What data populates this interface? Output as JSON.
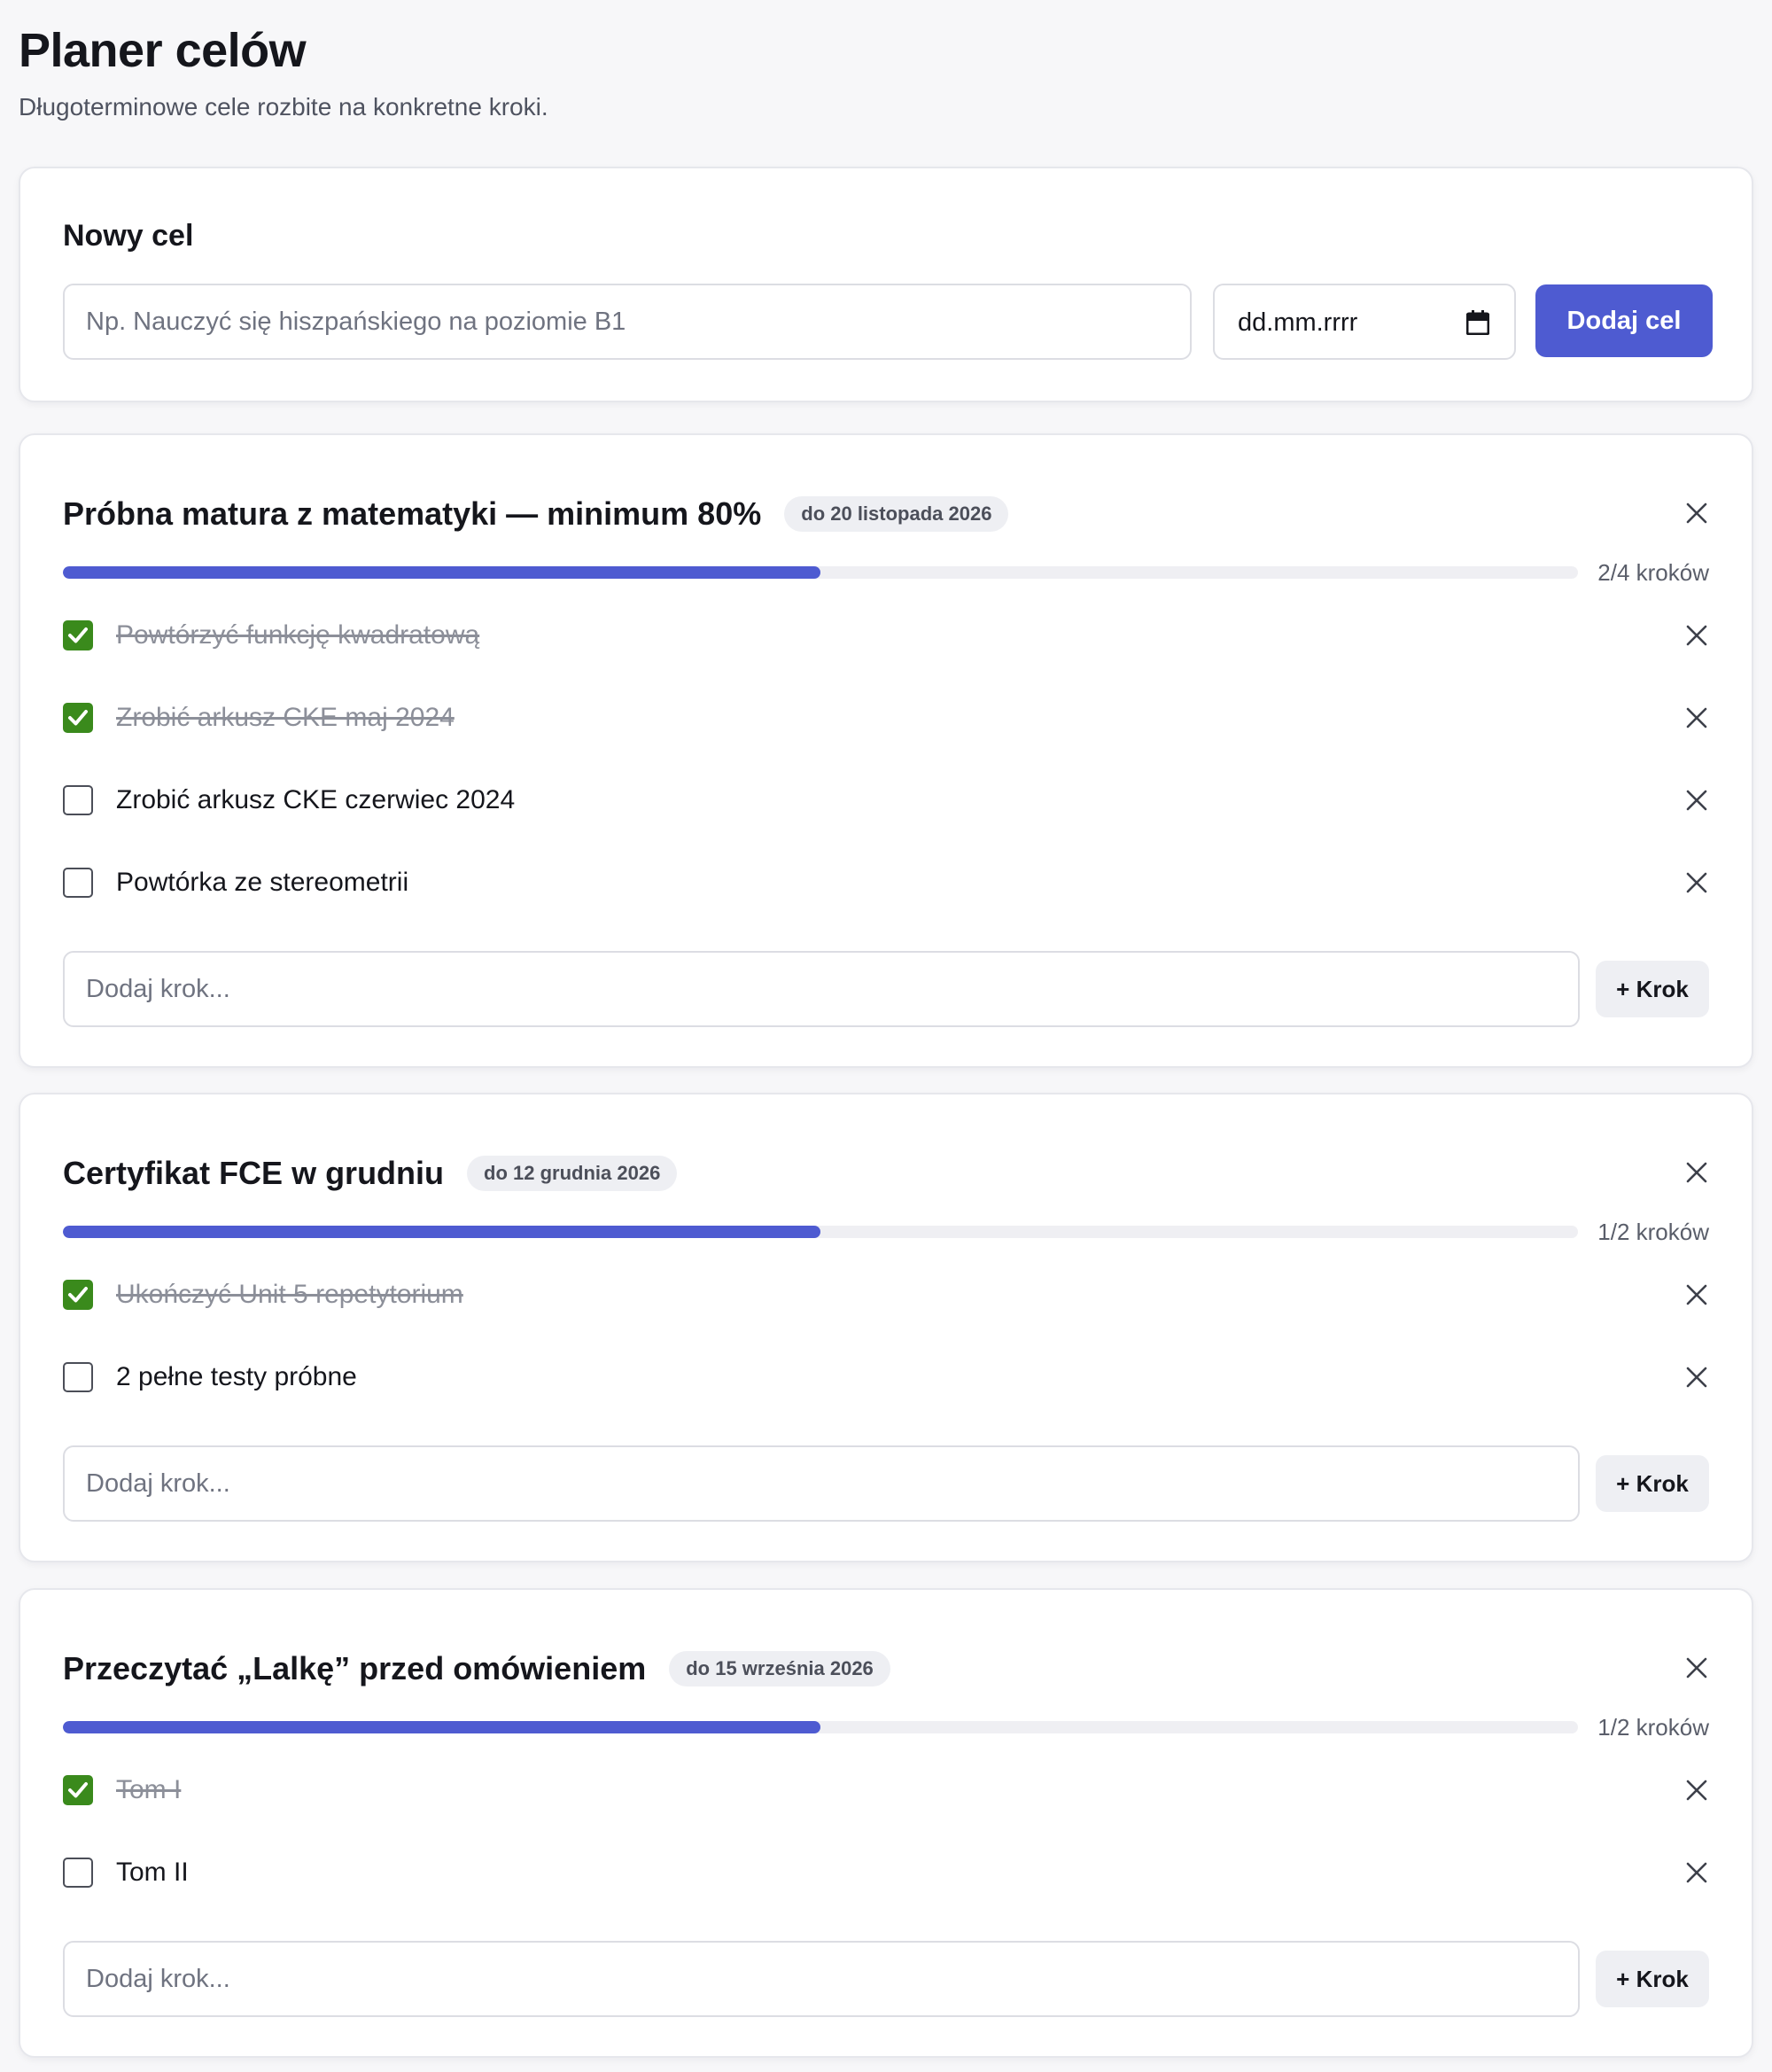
{
  "header": {
    "title": "Planer celów",
    "subtitle": "Długoterminowe cele rozbite na konkretne kroki."
  },
  "new_goal": {
    "title": "Nowy cel",
    "goal_placeholder": "Np. Nauczyć się hiszpańskiego na poziomie B1",
    "date_placeholder": "dd.mm.rrrr",
    "add_button": "Dodaj cel"
  },
  "goals": [
    {
      "title": "Próbna matura z matematyki — minimum 80%",
      "deadline": "do 20 listopada 2026",
      "progress_label": "2/4 kroków",
      "progress": 0.5,
      "steps": [
        {
          "text": "Powtórzyć funkcję kwadratową",
          "done": true
        },
        {
          "text": "Zrobić arkusz CKE maj 2024",
          "done": true
        },
        {
          "text": "Zrobić arkusz CKE czerwiec 2024",
          "done": false
        },
        {
          "text": "Powtórka ze stereometrii",
          "done": false
        }
      ],
      "step_placeholder": "Dodaj krok...",
      "add_step_button": "+ Krok"
    },
    {
      "title": "Certyfikat FCE w grudniu",
      "deadline": "do 12 grudnia 2026",
      "progress_label": "1/2 kroków",
      "progress": 0.5,
      "steps": [
        {
          "text": "Ukończyć Unit 5 repetytorium",
          "done": true
        },
        {
          "text": "2 pełne testy próbne",
          "done": false
        }
      ],
      "step_placeholder": "Dodaj krok...",
      "add_step_button": "+ Krok"
    },
    {
      "title": "Przeczytać „Lalkę” przed omówieniem",
      "deadline": "do 15 września 2026",
      "progress_label": "1/2 kroków",
      "progress": 0.5,
      "steps": [
        {
          "text": "Tom I",
          "done": true
        },
        {
          "text": "Tom II",
          "done": false
        }
      ],
      "step_placeholder": "Dodaj krok...",
      "add_step_button": "+ Krok"
    }
  ],
  "colors": {
    "accent": "#4e5bd1",
    "checked": "#3a8a1c",
    "track": "#efeff3"
  },
  "icons": {
    "close": "close-icon",
    "calendar": "calendar-icon",
    "check": "check-icon"
  }
}
